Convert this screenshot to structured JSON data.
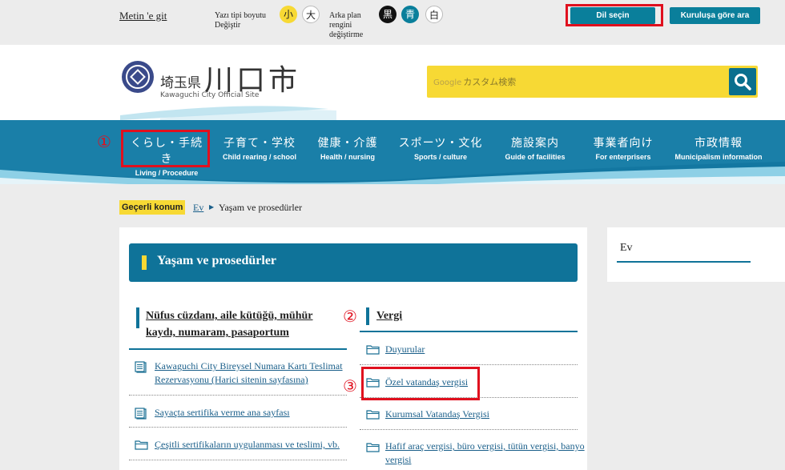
{
  "topbar": {
    "skip_link": "Metin 'e git",
    "font_size_label": "Yazı tipi boyutu Değiştir",
    "font_small": "小",
    "font_large": "大",
    "bg_label": "Arka plan rengini değiştirme",
    "bg_black": "黒",
    "bg_blue": "青",
    "bg_white": "白",
    "language_button": "Dil seçin",
    "org_search_button": "Kuruluşa göre ara"
  },
  "header": {
    "logo_pref": "埼玉県",
    "logo_city": "川口市",
    "logo_en": "Kawaguchi City Official Site",
    "search_brand": "Google",
    "search_placeholder": "カスタム検索"
  },
  "nav": {
    "items": [
      {
        "jp": "くらし・手続き",
        "en": "Living / Procedure"
      },
      {
        "jp": "子育て・学校",
        "en": "Child rearing / school"
      },
      {
        "jp": "健康・介護",
        "en": "Health / nursing"
      },
      {
        "jp": "スポーツ・文化",
        "en": "Sports / culture"
      },
      {
        "jp": "施設案内",
        "en": "Guide of facilities"
      },
      {
        "jp": "事業者向け",
        "en": "For enterprisers"
      },
      {
        "jp": "市政情報",
        "en": "Municipalism  information"
      }
    ]
  },
  "annotations": {
    "n1": "①",
    "n2": "②",
    "n3": "③"
  },
  "breadcrumb": {
    "label": "Geçerli konum",
    "home": "Ev",
    "current": "Yaşam ve prosedürler"
  },
  "main": {
    "title": "Yaşam ve prosedürler",
    "left_section": {
      "title_line1": "Nüfus cüzdanı, aile kütüğü, mühür",
      "title_line2": "kaydı, numaram, pasaportum",
      "links": [
        {
          "line1": "Kawaguchi City Bireysel Numara Kartı Teslimat",
          "line2": "Rezervasyonu (Harici sitenin sayfasına)",
          "icon": "document-icon"
        },
        {
          "line1": "Sayaçta sertifika verme ana sayfası",
          "icon": "document-icon"
        },
        {
          "line1": "Çeşitli sertifikaların uygulanması ve teslimi, vb.",
          "icon": "folder-icon"
        }
      ]
    },
    "right_section": {
      "title": "Vergi",
      "links": [
        {
          "line1": "Duyurular",
          "icon": "folder-icon"
        },
        {
          "line1": "Özel vatandaş vergisi",
          "icon": "folder-icon"
        },
        {
          "line1": "Kurumsal Vatandaş Vergisi",
          "icon": "folder-icon"
        },
        {
          "line1": "Hafif araç vergisi, büro vergisi, tütün vergisi, banyo",
          "line2": "vergisi",
          "icon": "folder-icon"
        }
      ]
    }
  },
  "sidebar": {
    "title": "Ev"
  },
  "colors": {
    "teal": "#0f7399",
    "yellow": "#f7d934",
    "red": "#e0101e"
  }
}
